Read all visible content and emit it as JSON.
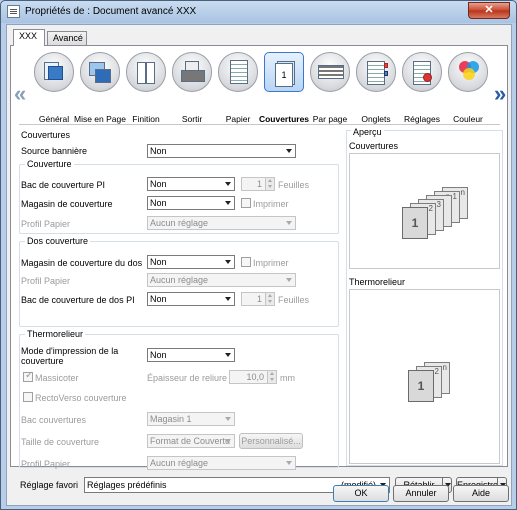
{
  "window": {
    "title": "Propriétés de : Document avancé XXX",
    "close_label": "✕"
  },
  "tabs": [
    {
      "label": "XXX"
    },
    {
      "label": "Avancé"
    }
  ],
  "toolbar": {
    "scroll_left": "«",
    "scroll_right": "»",
    "items": [
      {
        "label": "Général",
        "icon": "general-icon"
      },
      {
        "label": "Mise en Page",
        "icon": "layout-icon"
      },
      {
        "label": "Finition",
        "icon": "finishing-icon"
      },
      {
        "label": "Sortir",
        "icon": "output-icon"
      },
      {
        "label": "Papier",
        "icon": "paper-icon"
      },
      {
        "label": "Couvertures",
        "icon": "covers-icon",
        "selected": true
      },
      {
        "label": "Par page",
        "icon": "per-page-icon"
      },
      {
        "label": "Onglets",
        "icon": "tabs-icon"
      },
      {
        "label": "Réglages",
        "icon": "settings-icon"
      },
      {
        "label": "Couleur",
        "icon": "color-icon"
      }
    ]
  },
  "couvertures": {
    "title": "Couvertures",
    "source_banniere": {
      "label": "Source bannière",
      "value": "Non"
    },
    "couverture": {
      "title": "Couverture",
      "bac_pi": {
        "label": "Bac de couverture PI",
        "value": "Non",
        "spin": "1",
        "unit": "Feuilles"
      },
      "magasin": {
        "label": "Magasin de couverture",
        "value": "Non",
        "check_label": "Imprimer"
      },
      "profil": {
        "label": "Profil Papier",
        "value": "Aucun réglage"
      }
    },
    "dos": {
      "title": "Dos couverture",
      "magasin": {
        "label": "Magasin de couverture du dos",
        "value": "Non",
        "check_label": "Imprimer"
      },
      "profil": {
        "label": "Profil Papier",
        "value": "Aucun réglage"
      },
      "bac_pi": {
        "label": "Bac de couverture de dos PI",
        "value": "Non",
        "spin": "1",
        "unit": "Feuilles"
      }
    },
    "thermo": {
      "title": "Thermorelieur",
      "mode": {
        "label": "Mode d'impression de la couverture",
        "value": "Non"
      },
      "massicoter": {
        "label": "Massicoter"
      },
      "epaisseur": {
        "label": "Épaisseur de reliure",
        "value": "10,0",
        "unit": "mm"
      },
      "rectoverso": {
        "label": "RectoVerso couverture"
      },
      "bac": {
        "label": "Bac couvertures",
        "value": "Magasin 1"
      },
      "taille": {
        "label": "Taille de couverture",
        "value": "Format de Couvertu",
        "button": "Personnalisé..."
      },
      "profil": {
        "label": "Profil Papier",
        "value": "Aucun réglage"
      }
    }
  },
  "apercu": {
    "title": "Aperçu",
    "couvertures_label": "Couvertures",
    "thermo_label": "Thermorelieur",
    "pages_cov": [
      "1",
      "2",
      "3",
      "n-1",
      "n"
    ],
    "pages_thermo": [
      "1",
      "2",
      "n"
    ]
  },
  "footer": {
    "favori_label": "Réglage favori",
    "favori_value": "Réglages prédéfinis",
    "modifie": "(modifié)",
    "retablir": "Rétablir",
    "enregistrer": "Enregistrer",
    "ok": "OK",
    "annuler": "Annuler",
    "aide": "Aide"
  }
}
